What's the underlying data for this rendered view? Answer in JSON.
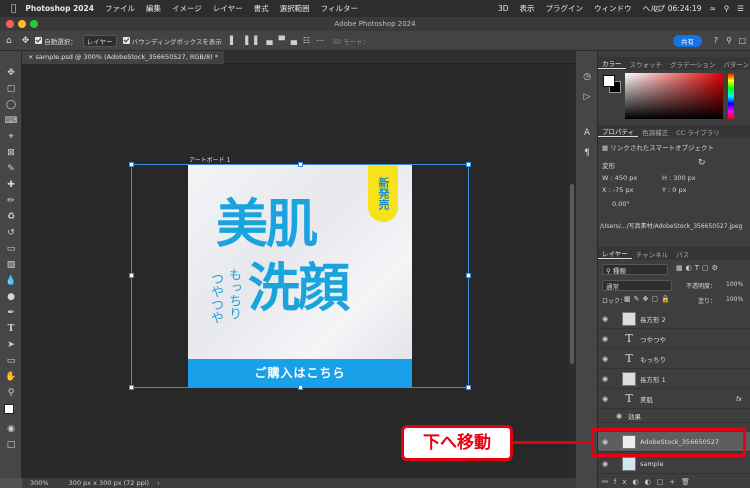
{
  "menubar": {
    "app": "Photoshop 2024",
    "items": [
      "ファイル",
      "編集",
      "イメージ",
      "レイヤー",
      "書式",
      "選択範囲",
      "フィルター",
      "3D",
      "表示",
      "プラグイン",
      "ウィンドウ",
      "ヘルプ"
    ],
    "clock": "06:24:19"
  },
  "window": {
    "title": "Adobe Photoshop 2024"
  },
  "options": {
    "auto_select": "自動選択：",
    "layer_select": "レイヤー",
    "bbox": "バウンディングボックスを表示",
    "mode3d": "3D モード：",
    "share": "共有"
  },
  "doc": {
    "tab": "sample.psd @ 300% (AdobeStock_356650527, RGB/8) *",
    "artboard_label": "アートボード 1"
  },
  "artwork": {
    "big1": "美肌",
    "big2": "洗顔",
    "sub1": "もっちり",
    "sub2": "つやつや",
    "badge": "新発売",
    "banner": "ご購入はこちら"
  },
  "status": {
    "zoom": "300%",
    "size": "300 px x 300 px (72 ppi)"
  },
  "color_tabs": [
    "カラー",
    "スウォッチ",
    "グラデーション",
    "パターン"
  ],
  "props": {
    "tabs": [
      "プロパティ",
      "色調補正",
      "CC ライブラリ"
    ],
    "smart": "リンクされたスマートオブジェクト",
    "transform": "変形",
    "w": "W : 450 px",
    "h": "H : 300 px",
    "x": "X : -75 px",
    "y": "Y : 0 px",
    "angle": "0.00°",
    "path": "/Users/.../写真素材/AdobeStock_356650527.jpeg"
  },
  "layers": {
    "tabs": [
      "レイヤー",
      "チャンネル",
      "パス"
    ],
    "kind": "種類",
    "blend": "通常",
    "opacity_label": "不透明度：",
    "opacity": "100%",
    "lock": "ロック：",
    "fill_label": "塗り：",
    "fill": "100%",
    "items": [
      "長方形 2",
      "つやつや",
      "もっちり",
      "長方形 1",
      "美肌",
      "効果",
      "AdobeStock_356650527",
      "sample"
    ]
  },
  "callout": "下へ移動"
}
